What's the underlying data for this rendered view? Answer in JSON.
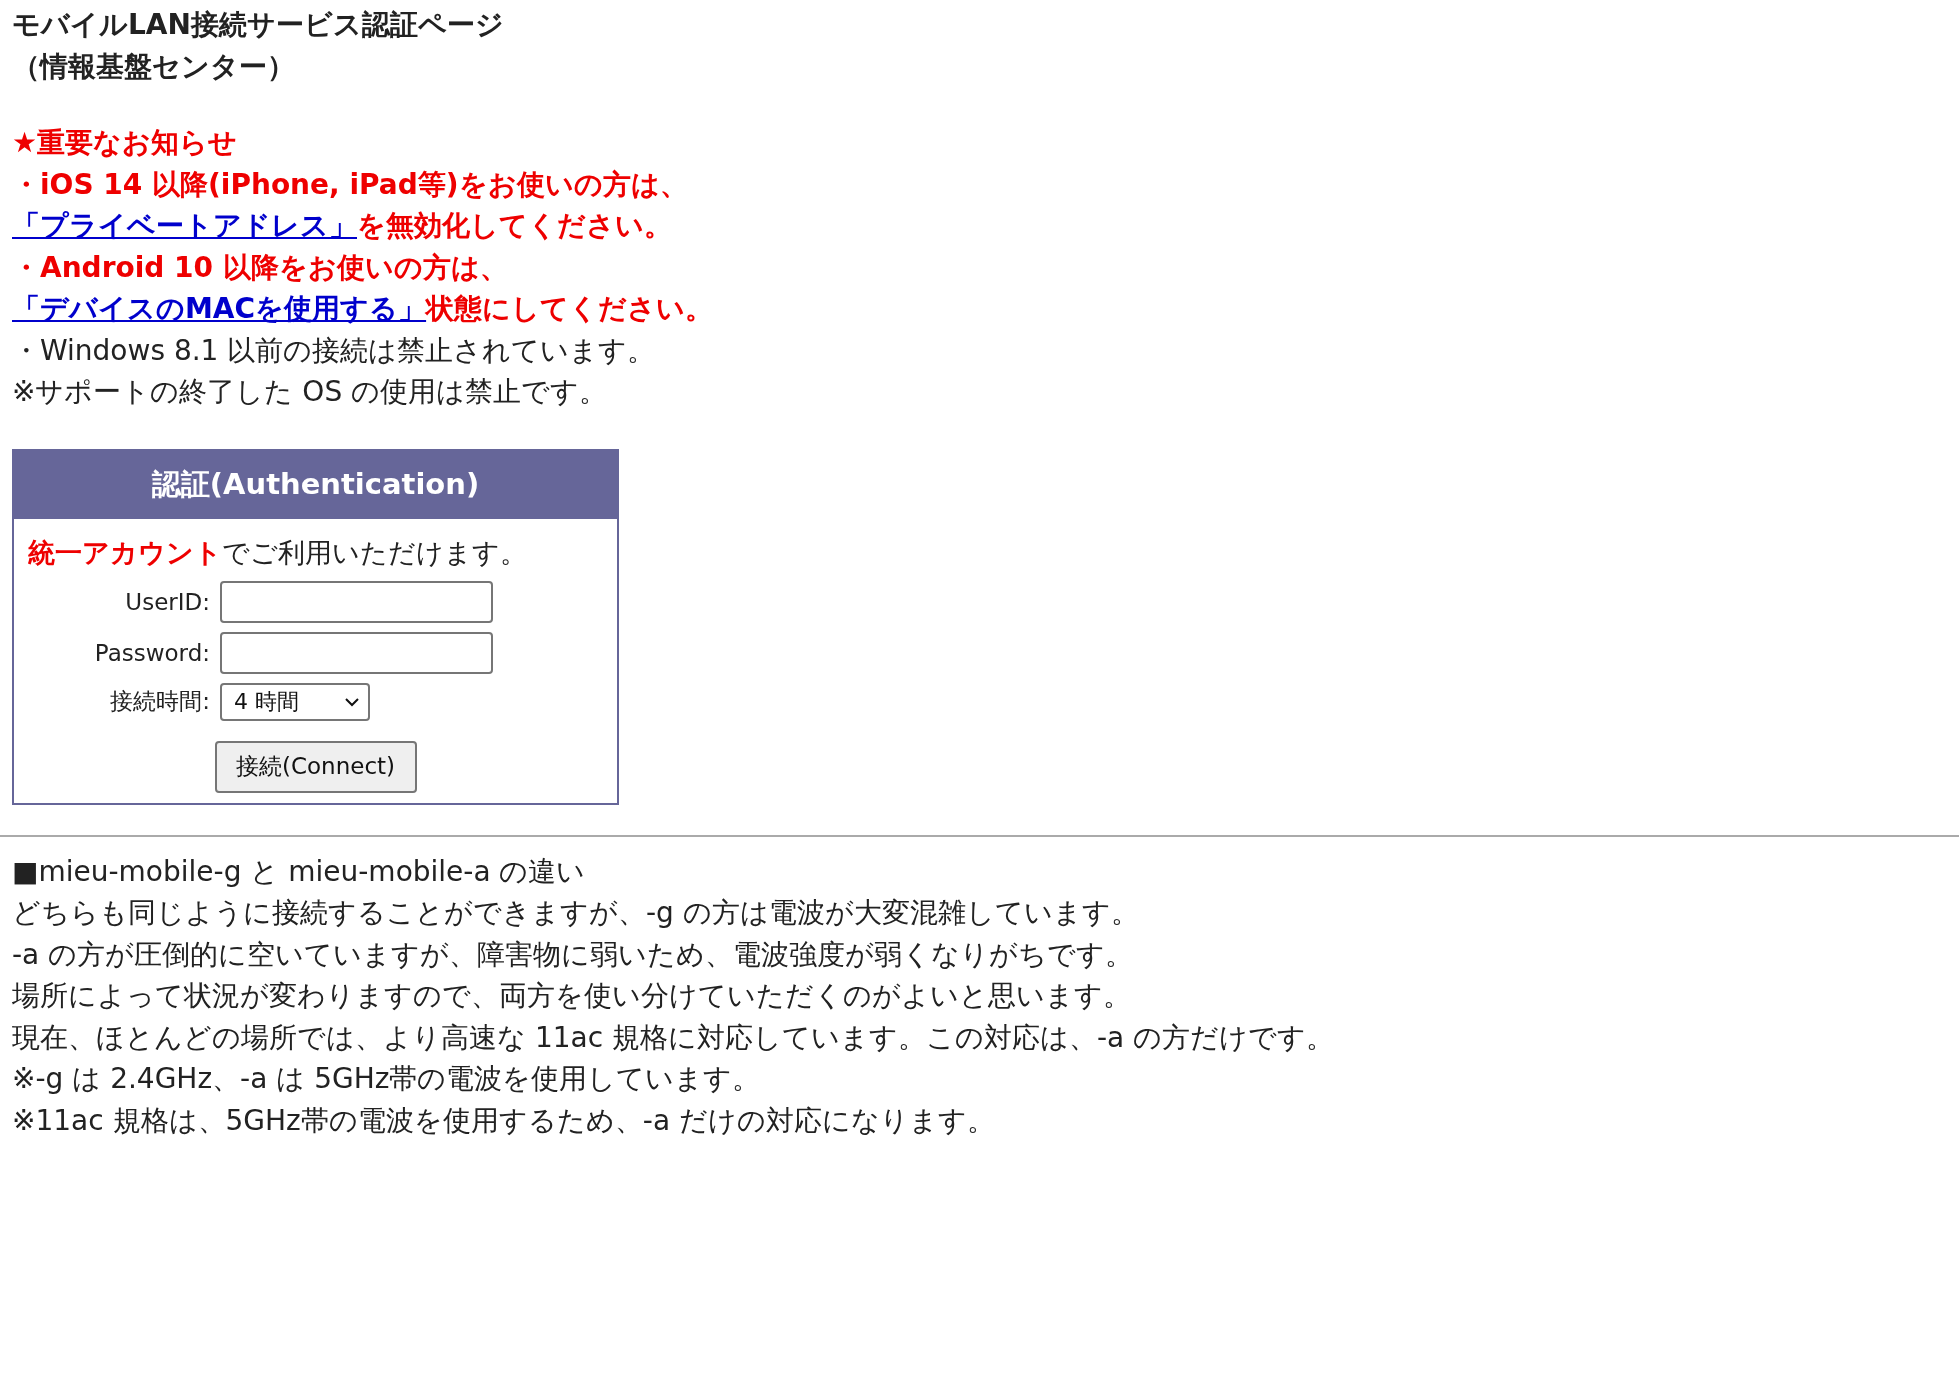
{
  "title_lines": [
    "モバイルLAN接続サービス認証ページ",
    "（情報基盤センター）"
  ],
  "notices": [
    {
      "kind": "heading",
      "text": "★重要なお知らせ"
    },
    {
      "kind": "alert",
      "text": "・iOS 14 以降(iPhone, iPad等)をお使いの方は、"
    },
    {
      "kind": "alert-link",
      "link": "「プライベートアドレス」",
      "text": "を無効化してください。"
    },
    {
      "kind": "alert",
      "text": "・Android 10 以降をお使いの方は、"
    },
    {
      "kind": "alert-link",
      "link": "「デバイスのMACを使用する」",
      "text": "状態にしてください。"
    },
    {
      "kind": "plain",
      "text": "・Windows 8.1 以前の接続は禁止されています。"
    },
    {
      "kind": "plain",
      "text": "※サポートの終了した OS の使用は禁止です。"
    }
  ],
  "auth": {
    "header": "認証(Authentication)",
    "intro": "**統一アカウント**でご利用いただけます。",
    "fields": [
      {
        "kind": "text",
        "label": "UserID:"
      },
      {
        "kind": "password",
        "label": "Password:"
      },
      {
        "kind": "select",
        "label": "接続時間:",
        "value": "4 時間"
      }
    ],
    "button": "接続(Connect)"
  },
  "notes": [
    "■mieu-mobile-g と mieu-mobile-a の違い",
    "どちらも同じように接続することができますが、-g の方は電波が大変混雑しています。",
    "-a の方が圧倒的に空いていますが、障害物に弱いため、電波強度が弱くなりがちです。",
    "場所によって状況が変わりますので、両方を使い分けていただくのがよいと思います。",
    "現在、ほとんどの場所では、より高速な 11ac 規格に対応しています。この対応は、-a の方だけです。",
    "※-g は 2.4GHz、-a は 5GHz帯の電波を使用しています。",
    "※11ac 規格は、5GHz帯の電波を使用するため、-a だけの対応になります。"
  ]
}
